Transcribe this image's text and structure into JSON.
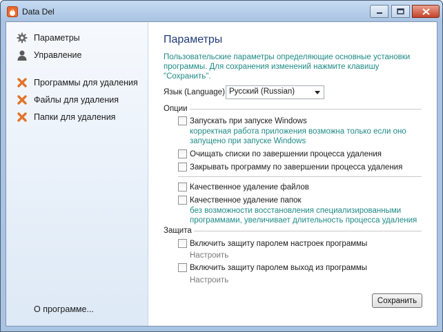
{
  "window": {
    "title": "Data Del"
  },
  "sidebar": {
    "items": [
      {
        "label": "Параметры",
        "icon": "gear-icon"
      },
      {
        "label": "Управление",
        "icon": "user-icon"
      },
      {
        "label": "Программы для удаления",
        "icon": "cross-icon"
      },
      {
        "label": "Файлы для удаления",
        "icon": "cross-icon"
      },
      {
        "label": "Папки для удаления",
        "icon": "cross-icon"
      }
    ],
    "about": "О программе..."
  },
  "main": {
    "title": "Параметры",
    "description": "Пользовательские параметры определяющие основные установки программы. Для сохранения изменений нажмите клавишу \"Сохранить\".",
    "language_label": "Язык (Language)",
    "language_value": "Русский (Russian)",
    "options_label": "Опции",
    "options": {
      "run_on_startup": "Запускать при запуске Windows",
      "run_on_startup_note": "корректная работа приложения возможна только если оно запущено при запуске Windows",
      "clear_lists": "Очищать списки по завершении процесса удаления",
      "close_program": "Закрывать программу по завершении процесса удаления",
      "quality_files": "Качественное удаление файлов",
      "quality_folders": "Качественное удаление папок",
      "quality_folders_note": "без возможности восстановления специализированными программами, увеличивает длительность процесса удаления"
    },
    "protection_label": "Защита",
    "protection": {
      "settings_password": "Включить защиту паролем настроек программы",
      "settings_configure": "Настроить",
      "exit_password": "Включить защиту паролем выход из программы",
      "exit_configure": "Настроить"
    },
    "save_label": "Сохранить"
  },
  "colors": {
    "accent_title": "#1f3c78",
    "note_text": "#1f8a86",
    "cross_icon": "#e2742a"
  }
}
